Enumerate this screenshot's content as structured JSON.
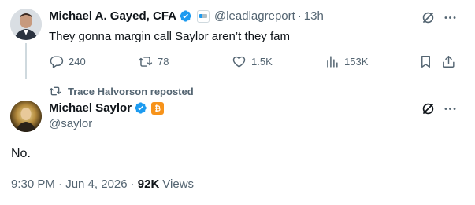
{
  "quoted_tweet": {
    "author_name": "Michael A. Gayed, CFA",
    "handle": "@leadlagreport",
    "separator": "·",
    "time": "13h",
    "text": "They gonna margin call Saylor aren’t they fam",
    "replies": "240",
    "reposts": "78",
    "likes": "1.5K",
    "views": "153K"
  },
  "repost_label": "Trace Halvorson reposted",
  "main_tweet": {
    "author_name": "Michael Saylor",
    "handle": "@saylor",
    "text": "No.",
    "timestamp": "9:30 PM · Jun 4, 2026 · ",
    "views_count": "92K",
    "views_label": "Views"
  },
  "colors": {
    "verified_blue": "#1d9bf0",
    "bitcoin_orange": "#f7931a",
    "muted_text": "#536471"
  },
  "icons": [
    "grok-icon",
    "more-icon",
    "reply-icon",
    "repost-icon",
    "like-icon",
    "views-icon",
    "bookmark-icon",
    "share-icon",
    "verified-icon",
    "bitcoin-badge-icon",
    "affiliate-badge-icon"
  ]
}
